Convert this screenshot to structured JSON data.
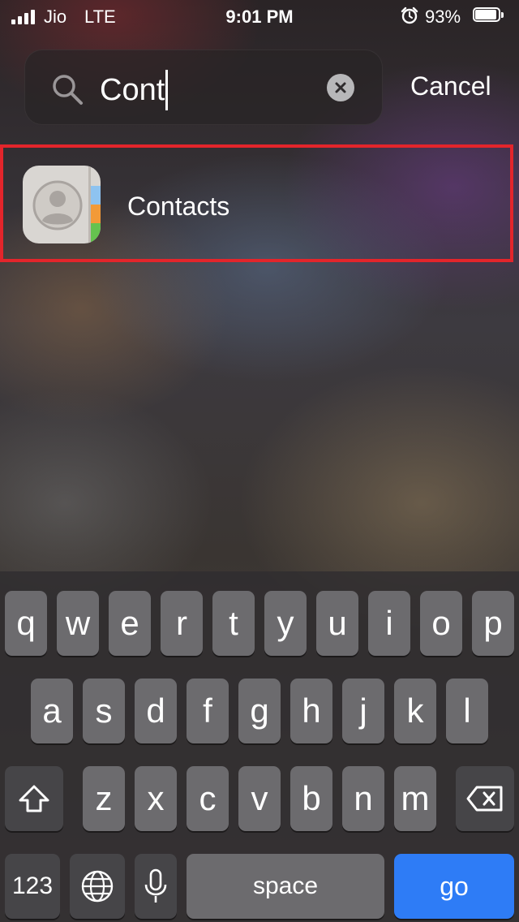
{
  "status_bar": {
    "carrier": "Jio",
    "network": "LTE",
    "time": "9:01 PM",
    "battery_percent": "93%",
    "battery_level": 0.93,
    "icons": [
      "signal-icon",
      "alarm-icon",
      "battery-icon"
    ]
  },
  "search": {
    "query": "Cont",
    "cancel_label": "Cancel",
    "icons": [
      "search-icon",
      "clear-icon"
    ]
  },
  "results": [
    {
      "label": "Contacts",
      "icon": "contacts-app-icon"
    }
  ],
  "colors": {
    "highlight_border": "#e3252b",
    "go_key": "#2e7cf6",
    "contacts_tabs": [
      "#8ec3f0",
      "#f29a38",
      "#65c24f"
    ]
  },
  "keyboard": {
    "row1": [
      "q",
      "w",
      "e",
      "r",
      "t",
      "y",
      "u",
      "i",
      "o",
      "p"
    ],
    "row2": [
      "a",
      "s",
      "d",
      "f",
      "g",
      "h",
      "j",
      "k",
      "l"
    ],
    "row3": [
      "z",
      "x",
      "c",
      "v",
      "b",
      "n",
      "m"
    ],
    "numbers_label": "123",
    "space_label": "space",
    "go_label": "go",
    "icons": [
      "shift-icon",
      "delete-icon",
      "globe-icon",
      "microphone-icon"
    ]
  }
}
